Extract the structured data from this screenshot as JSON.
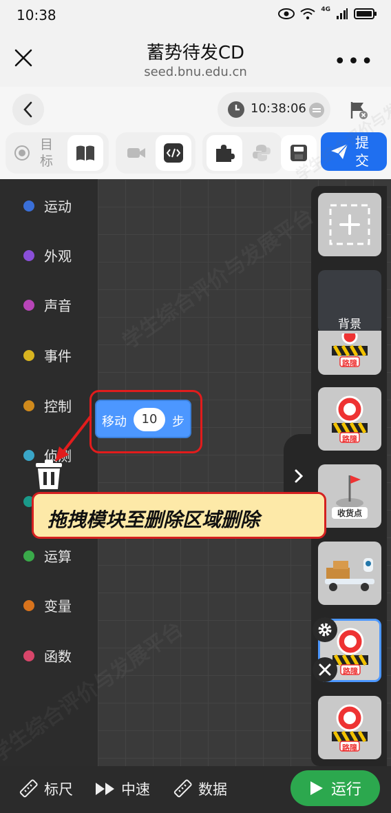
{
  "status_bar": {
    "time": "10:38",
    "network": "4G"
  },
  "header": {
    "title": "蓄势待发CD",
    "url": "seed.bnu.edu.cn"
  },
  "toolbar": {
    "timer": "10:38:06",
    "target_label": "目标",
    "submit_label": "提交"
  },
  "categories": [
    {
      "label": "运动",
      "color": "#3a6fd8"
    },
    {
      "label": "外观",
      "color": "#8a4fd8"
    },
    {
      "label": "声音",
      "color": "#b845b8"
    },
    {
      "label": "事件",
      "color": "#d8b420"
    },
    {
      "label": "控制",
      "color": "#d08a1c"
    },
    {
      "label": "侦测",
      "color": "#3aa6c8"
    },
    {
      "label": "运算",
      "color": "#3aaa4a"
    },
    {
      "label": "变量",
      "color": "#d8731c"
    },
    {
      "label": "函数",
      "color": "#d8466a"
    }
  ],
  "block": {
    "left_label": "移动",
    "value": "10",
    "right_label": "步"
  },
  "tooltip": {
    "text": "拖拽模块至删除区域删除"
  },
  "sprites": {
    "background_label": "背景",
    "roadblock_label": "路障",
    "destination_label": "收货点"
  },
  "bottom_bar": {
    "ruler_label": "标尺",
    "speed_label": "中速",
    "data_label": "数据",
    "run_label": "运行"
  },
  "watermark": "学生综合评价与发展平台",
  "colors": {
    "accent": "#1f6ff0",
    "run": "#2ca84e",
    "highlight": "#e21c1c",
    "tooltip_bg": "#fde9a8",
    "block": "#4c97ff"
  }
}
